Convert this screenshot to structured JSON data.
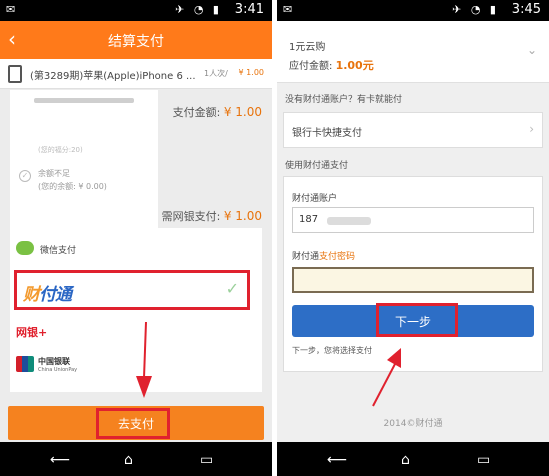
{
  "left": {
    "status": {
      "time": "3:41"
    },
    "header": {
      "back": "‹",
      "title": "结算支付"
    },
    "product": {
      "name": "(第3289期)苹果(Apple)iPhone 6 ...",
      "qty": "1人次/",
      "price": "¥ 1.00"
    },
    "pay_amount": {
      "label": "支付金额:",
      "value": "¥ 1.00"
    },
    "balance": {
      "faded": "(您的福分:20)",
      "title": "余额不足",
      "amount": "(您的余额: ¥ 0.00)"
    },
    "bank_amount": {
      "label": "需网银支付:",
      "value": "¥ 1.00"
    },
    "methods": {
      "wechat": "微信支付",
      "tenpay_logo_a": "财",
      "tenpay_logo_b": "付通",
      "tenpay_selected": "✓",
      "netbank": "网银+",
      "unionpay_cn": "中国银联",
      "unionpay_en": "China UnionPay"
    },
    "pay_button": "去支付"
  },
  "right": {
    "status": {
      "time": "3:45"
    },
    "header": {
      "item": "1元云购",
      "amount_label": "应付金额:",
      "amount_value": "1.00元",
      "chevron": "⌄"
    },
    "no_account": "没有财付通账户？有卡就能付",
    "bank_quick": {
      "label": "银行卡快捷支付",
      "chevron": "›"
    },
    "use_tenpay": "使用财付通支付",
    "form": {
      "account_label": "财付通账户",
      "account_value": "187",
      "password_label_a": "财付通",
      "password_label_b": "支付密码",
      "next_button": "下一步",
      "hint": "下一步，您将选择支付"
    },
    "copyright": "2014©财付通"
  },
  "nav": {
    "back": "⟵",
    "home": "⌂",
    "recent": "▭"
  },
  "colors": {
    "orange": "#ff7a1a",
    "highlight_red": "#e0212e",
    "blue": "#2d6ec6"
  }
}
